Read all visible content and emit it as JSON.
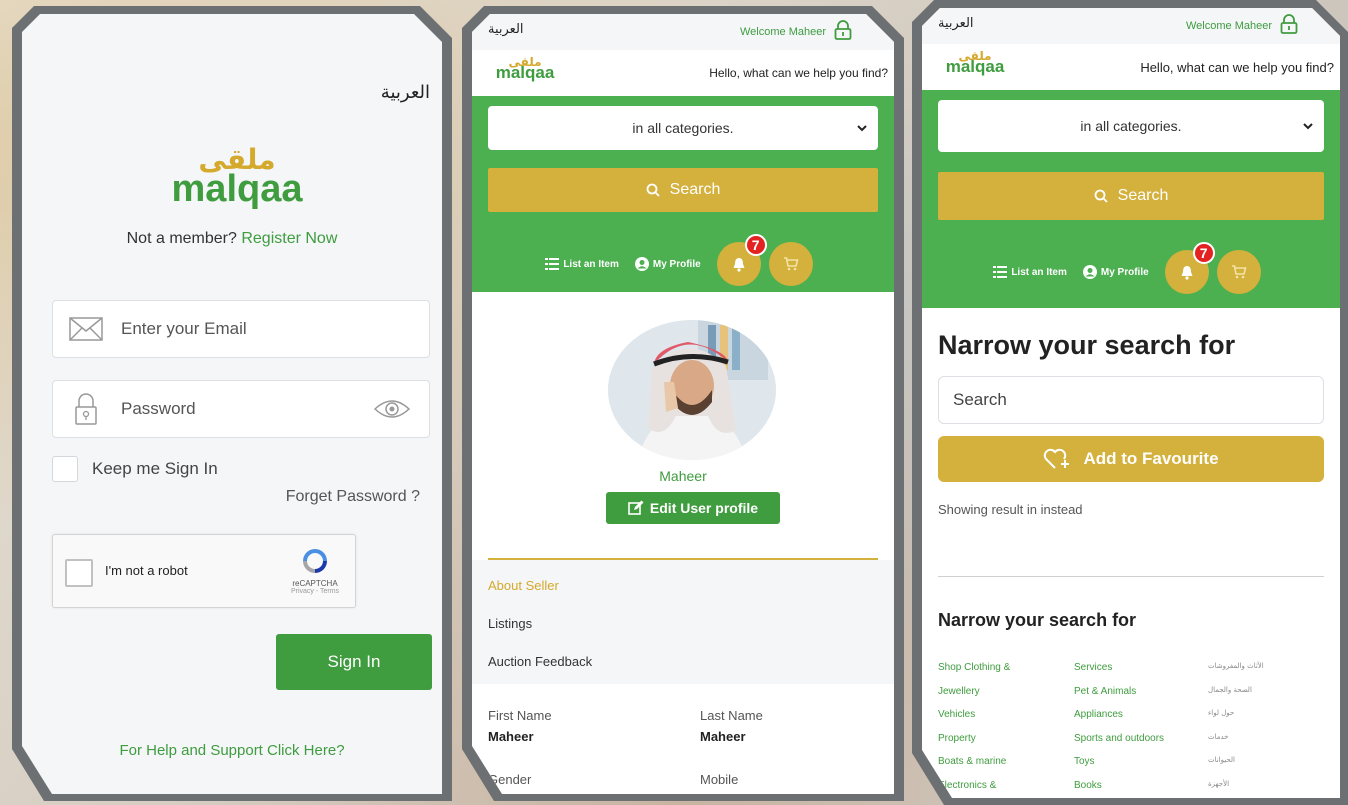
{
  "login": {
    "language_toggle": "العربية",
    "logo_arabic": "ملقى",
    "logo_text": "malqaa",
    "not_member": "Not a member?",
    "register_link": "Register Now",
    "email_placeholder": "Enter your Email",
    "password_placeholder": "Password",
    "keep_signed_in": "Keep me Sign In",
    "forget_password": "Forget Password ?",
    "captcha_label": "I'm not a robot",
    "captcha_brand": "reCAPTCHA",
    "captcha_links": "Privacy - Terms",
    "sign_in": "Sign In",
    "help_link": "For Help and Support Click Here?"
  },
  "header": {
    "language_toggle": "العربية",
    "welcome": "Welcome Maheer",
    "logo_arabic": "ملقى",
    "logo_text": "malqaa",
    "hello": "Hello, what can we help you find?",
    "category_select": "in all categories.",
    "search_button": "Search",
    "list_item": "List an Item",
    "my_profile": "My Profile",
    "notification_count": "7"
  },
  "profile": {
    "user_name": "Maheer",
    "edit_button": "Edit User profile",
    "tabs": [
      "About Seller",
      "Listings",
      "Auction Feedback"
    ],
    "first_name_label": "First Name",
    "first_name_value": "Maheer",
    "last_name_label": "Last Name",
    "last_name_value": "Maheer",
    "gender_label": "Gender",
    "mobile_label": "Mobile"
  },
  "search_page": {
    "heading": "Narrow your search for",
    "search_placeholder": "Search",
    "add_favourite": "Add to Favourite",
    "showing_result": "Showing result in instead",
    "subheading": "Narrow your search for",
    "categories_col1": [
      "Shop Clothing &",
      "Jewellery",
      "Vehicles",
      "Property",
      "Boats & marine",
      "Electronics &"
    ],
    "categories_col2": [
      "Services",
      "Pet & Animals",
      "Appliances",
      "Sports and outdoors",
      "Toys",
      "Books"
    ],
    "categories_col3": [
      "الأثاث والمفروشات",
      "الصحة والجمال",
      "حول لواء",
      "خدمات",
      "الحيوانات",
      "الأجهزة"
    ]
  },
  "colors": {
    "brand_green": "#4caf50",
    "brand_gold": "#d4b03d",
    "badge_red": "#e32222"
  }
}
